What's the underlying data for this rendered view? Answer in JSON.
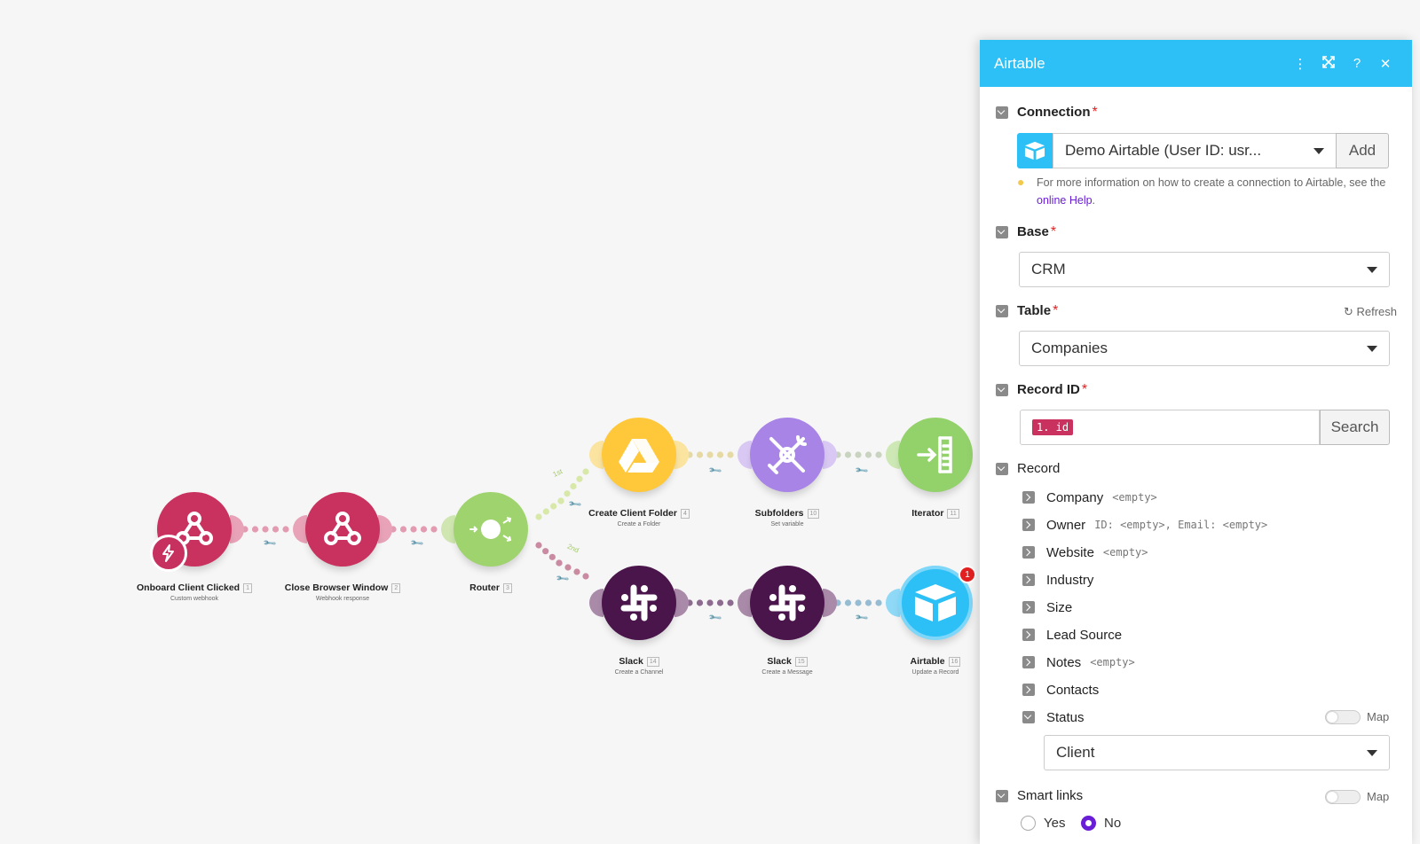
{
  "scenario": {
    "modules": [
      {
        "id": "m1",
        "name": "Onboard Client Clicked",
        "index": "1",
        "subtitle": "Custom webhook",
        "color": "#c9325f",
        "icon": "webhook-icon"
      },
      {
        "id": "m2",
        "name": "Close Browser Window",
        "index": "2",
        "subtitle": "Webhook response",
        "color": "#c9325f",
        "icon": "webhook-icon"
      },
      {
        "id": "m3",
        "name": "Router",
        "index": "3",
        "subtitle": "",
        "color": "#9fd36e",
        "icon": "router-icon"
      },
      {
        "id": "m4",
        "name": "Create Client Folder",
        "index": "4",
        "subtitle": "Create a Folder",
        "color": "#ffc73a",
        "icon": "google-drive-icon"
      },
      {
        "id": "m5",
        "name": "Subfolders",
        "index": "10",
        "subtitle": "Set variable",
        "color": "#a884e6",
        "icon": "tools-icon"
      },
      {
        "id": "m6",
        "name": "Iterator",
        "index": "11",
        "subtitle": "",
        "color": "#93d16b",
        "icon": "iterator-icon"
      },
      {
        "id": "m7",
        "name": "Slack",
        "index": "14",
        "subtitle": "Create a Channel",
        "color": "#4a154b",
        "icon": "slack-icon"
      },
      {
        "id": "m8",
        "name": "Slack",
        "index": "15",
        "subtitle": "Create a Message",
        "color": "#4a154b",
        "icon": "slack-icon"
      },
      {
        "id": "m9",
        "name": "Airtable",
        "index": "16",
        "subtitle": "Update a Record",
        "color": "#2dc0f6",
        "icon": "airtable-icon",
        "badge": "1"
      }
    ],
    "route_labels": [
      "1st",
      "2nd"
    ]
  },
  "panel": {
    "title": "Airtable",
    "header_buttons": [
      "more-icon",
      "expand-icon",
      "help-icon",
      "close-icon"
    ],
    "connection": {
      "label": "Connection",
      "value": "Demo Airtable (User ID: usr...",
      "add_label": "Add",
      "hint_prefix": "For more information on how to create a connection to Airtable, see the",
      "hint_link": "online Help",
      "hint_suffix": "."
    },
    "base": {
      "label": "Base",
      "value": "CRM"
    },
    "table": {
      "label": "Table",
      "value": "Companies",
      "refresh_label": "Refresh"
    },
    "record_id": {
      "label": "Record ID",
      "pill": "1. id",
      "search_label": "Search"
    },
    "record": {
      "label": "Record",
      "fields": [
        {
          "label": "Company",
          "hint": "<empty>"
        },
        {
          "label": "Owner",
          "hint": "ID: <empty>, Email: <empty>"
        },
        {
          "label": "Website",
          "hint": "<empty>"
        },
        {
          "label": "Industry",
          "hint": ""
        },
        {
          "label": "Size",
          "hint": ""
        },
        {
          "label": "Lead Source",
          "hint": ""
        },
        {
          "label": "Notes",
          "hint": "<empty>"
        },
        {
          "label": "Contacts",
          "hint": ""
        }
      ],
      "status": {
        "label": "Status",
        "map_label": "Map",
        "value": "Client"
      }
    },
    "smart_links": {
      "label": "Smart links",
      "map_label": "Map",
      "yes_label": "Yes",
      "no_label": "No",
      "selected": "No"
    },
    "colors": {
      "accent": "#2dc0f6",
      "required": "#e32020",
      "radio": "#6a1dd6",
      "link": "#6a1dd6",
      "pill": "#c9325f"
    }
  }
}
